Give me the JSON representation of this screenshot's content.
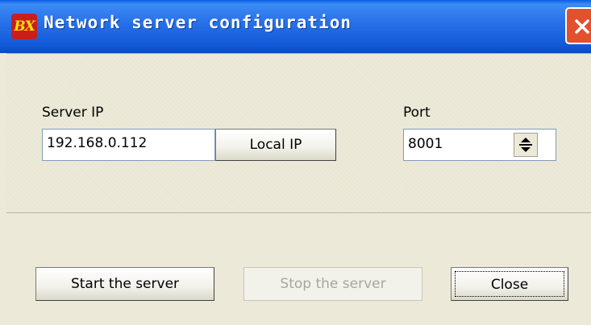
{
  "window": {
    "title": "Network server configuration",
    "icon_text": "BX",
    "close_glyph": "✕"
  },
  "server": {
    "ip_label": "Server IP",
    "ip_value": "192.168.0.112",
    "local_ip_button": "Local IP",
    "port_label": "Port",
    "port_value": "8001"
  },
  "actions": {
    "start_label": "Start the server",
    "stop_label": "Stop the server",
    "close_label": "Close"
  },
  "colors": {
    "titlebar": "#2a72ea",
    "window_bg": "#ece9d8",
    "close_button": "#e2502f"
  }
}
